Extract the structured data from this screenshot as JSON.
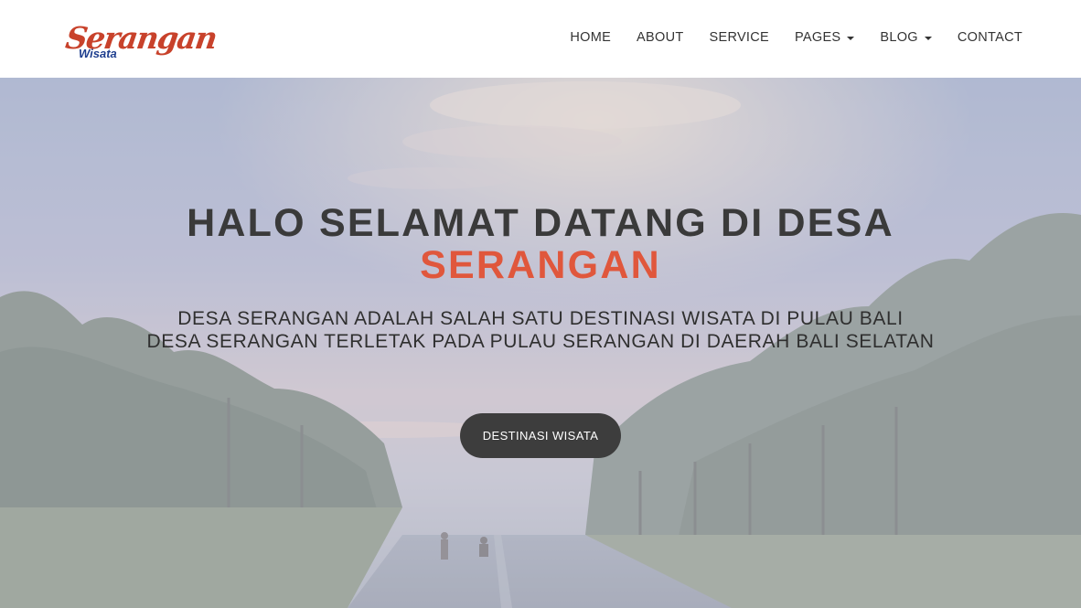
{
  "brand": {
    "logo_script": "Serangan",
    "logo_sub": "Wisata",
    "logo_color": "#c8422b",
    "logo_sub_color": "#1f3f8f"
  },
  "nav": {
    "items": [
      {
        "label": "HOME",
        "dropdown": false
      },
      {
        "label": "ABOUT",
        "dropdown": false
      },
      {
        "label": "SERVICE",
        "dropdown": false
      },
      {
        "label": "PAGES",
        "dropdown": true
      },
      {
        "label": "BLOG",
        "dropdown": true
      },
      {
        "label": "CONTACT",
        "dropdown": false
      }
    ]
  },
  "hero": {
    "title": "HALO SELAMAT DATANG DI DESA",
    "title_accent": "SERANGAN",
    "accent_color": "#e0573c",
    "text_line1": "DESA SERANGAN ADALAH SALAH SATU DESTINASI WISATA DI PULAU BALI",
    "text_line2": "DESA SERANGAN TERLETAK PADA PULAU SERANGAN DI DAERAH BALI SELATAN",
    "cta_label": "DESTINASI WISATA"
  }
}
